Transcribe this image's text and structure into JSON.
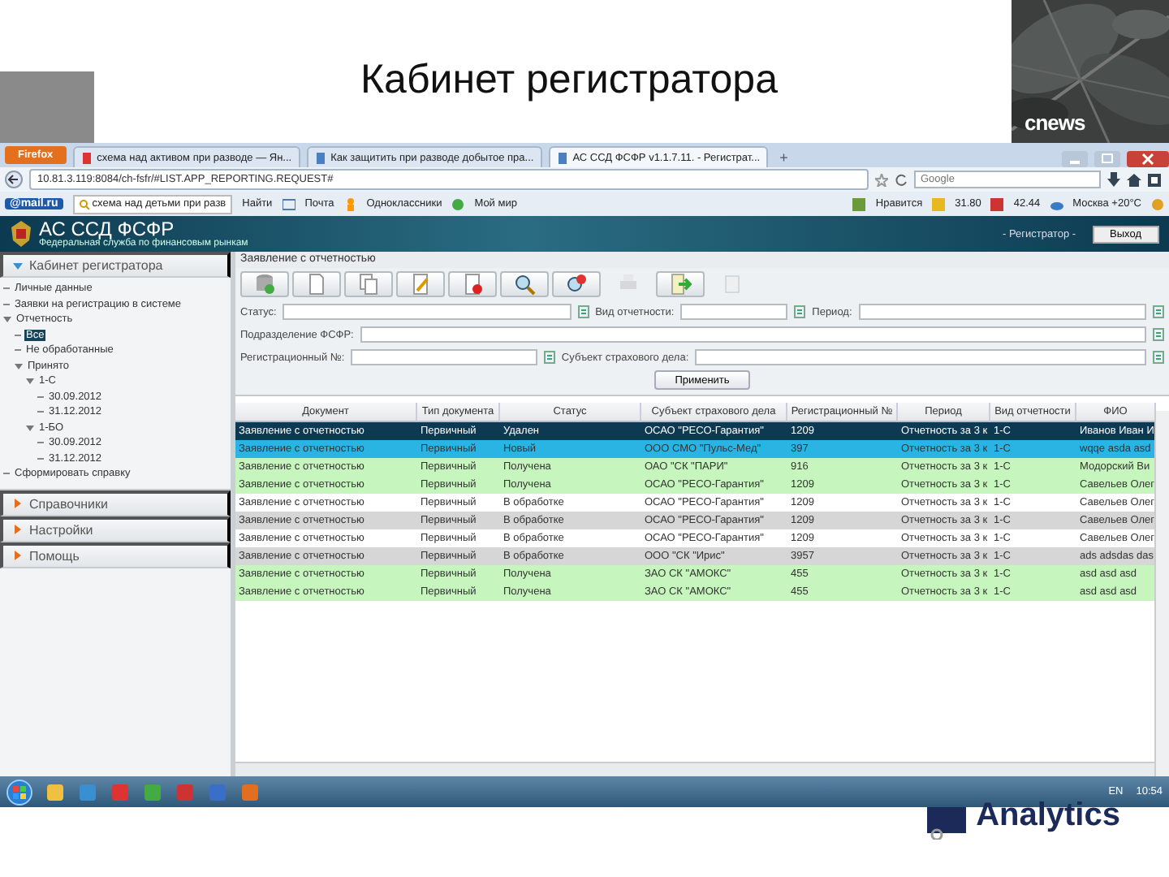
{
  "slide": {
    "title": "Кабинет регистратора",
    "logo": "cnews",
    "footer_logo": "Analytics"
  },
  "browser": {
    "menu_button": "Firefox",
    "tabs": [
      {
        "label": "схема над активом при разводе — Ян...",
        "selected": false
      },
      {
        "label": "Как защитить при разводе добытое пра...",
        "selected": false
      },
      {
        "label": "АС ССД ФСФР v1.1.7.11. - Регистрат...",
        "selected": true
      }
    ],
    "new_tab": "+",
    "address": "10.81.3.119:8084/ch-fsfr/#LIST.APP_REPORTING.REQUEST#",
    "search_placeholder": "Google"
  },
  "bookmarks": {
    "logo": "@mail.ru",
    "search": "схема над детьми при разв",
    "find": "Найти",
    "items": [
      "Почта",
      "Одноклассники",
      "Мой мир"
    ],
    "right_items": [
      "Нравится",
      "31.80",
      "42.44",
      "Москва +20°C"
    ]
  },
  "app": {
    "title": "АС ССД ФСФР",
    "subtitle": "Федеральная служба по финансовым рынкам",
    "user": "- Регистратор -",
    "logout": "Выход"
  },
  "sidebar": [
    {
      "label": "Кабинет регистратора",
      "expanded": true,
      "tree": [
        {
          "label": "Личные данные",
          "selected": false
        },
        {
          "label": "Заявки на регистрацию в системе",
          "selected": false
        },
        {
          "label": "Отчетность",
          "selected": false,
          "expanded": true,
          "children": [
            {
              "label": "Все",
              "selected": true
            },
            {
              "label": "Не обработанные",
              "selected": false
            },
            {
              "label": "Принято",
              "selected": false,
              "expanded": true,
              "children": [
                {
                  "label": "1-С",
                  "selected": false,
                  "expanded": true,
                  "children": [
                    {
                      "label": "30.09.2012",
                      "selected": false
                    },
                    {
                      "label": "31.12.2012",
                      "selected": false
                    }
                  ]
                },
                {
                  "label": "1-БО",
                  "selected": false,
                  "expanded": true,
                  "children": [
                    {
                      "label": "30.09.2012",
                      "selected": false
                    },
                    {
                      "label": "31.12.2012",
                      "selected": false
                    }
                  ]
                }
              ]
            }
          ]
        },
        {
          "label": "Сформировать справку",
          "selected": false
        }
      ]
    },
    {
      "label": "Справочники",
      "expanded": false
    },
    {
      "label": "Настройки",
      "expanded": false
    },
    {
      "label": "Помощь",
      "expanded": false
    }
  ],
  "panel": {
    "title": "Заявление с отчетностью",
    "toolbar": [
      {
        "kind": "database",
        "disabled": false
      },
      {
        "kind": "new",
        "disabled": false
      },
      {
        "kind": "copy",
        "disabled": false
      },
      {
        "kind": "edit",
        "disabled": false
      },
      {
        "kind": "delete",
        "disabled": false
      },
      {
        "kind": "search",
        "disabled": false
      },
      {
        "kind": "clear",
        "disabled": false
      },
      {
        "kind": "print",
        "disabled": true
      },
      {
        "kind": "export",
        "disabled": false
      },
      {
        "kind": "check",
        "disabled": true
      }
    ],
    "filters": [
      [
        {
          "label": "Статус:"
        },
        {
          "label": "Вид отчетности:"
        },
        {
          "label": "Период:"
        }
      ],
      [
        {
          "label": "Подразделение ФСФР:"
        }
      ],
      [
        {
          "label": "Регистрационный №:"
        },
        {
          "label": "Субъект страхового дела:"
        }
      ]
    ],
    "apply": "Применить"
  },
  "table": {
    "columns": [
      "Документ",
      "Тип документа",
      "Статус",
      "Субъект страхового дела",
      "Регистрационный №",
      "Период",
      "Вид отчетности",
      "ФИО"
    ],
    "rows": [
      {
        "color": "#0d3a52",
        "selected": true,
        "cells": [
          "Заявление с отчетностью",
          "Первичный",
          "Удален",
          "ОСАО \"РЕСО-Гарантия\"",
          "1209",
          "Отчетность за 3 к",
          "1-С",
          "Иванов Иван И"
        ]
      },
      {
        "color": "#2ab4e4",
        "selected": false,
        "cells": [
          "Заявление с отчетностью",
          "Первичный",
          "Новый",
          "ООО СМО \"Пульс-Мед\"",
          "397",
          "Отчетность за 3 к",
          "1-С",
          "wqqe asda asd"
        ]
      },
      {
        "color": "#c6f5bd",
        "selected": false,
        "cells": [
          "Заявление с отчетностью",
          "Первичный",
          "Получена",
          "ОАО \"СК \"ПАРИ\"",
          "916",
          "Отчетность за 3 к",
          "1-С",
          "Модорский Ви"
        ]
      },
      {
        "color": "#c6f5bd",
        "selected": false,
        "cells": [
          "Заявление с отчетностью",
          "Первичный",
          "Получена",
          "ОСАО \"РЕСО-Гарантия\"",
          "1209",
          "Отчетность за 3 к",
          "1-С",
          "Савельев Олег"
        ]
      },
      {
        "color": "#ffffff",
        "selected": false,
        "cells": [
          "Заявление с отчетностью",
          "Первичный",
          "В обработке",
          "ОСАО \"РЕСО-Гарантия\"",
          "1209",
          "Отчетность за 3 к",
          "1-С",
          "Савельев Олег"
        ]
      },
      {
        "color": "#d6d6d6",
        "selected": false,
        "cells": [
          "Заявление с отчетностью",
          "Первичный",
          "В обработке",
          "ОСАО \"РЕСО-Гарантия\"",
          "1209",
          "Отчетность за 3 к",
          "1-С",
          "Савельев Олег"
        ]
      },
      {
        "color": "#ffffff",
        "selected": false,
        "cells": [
          "Заявление с отчетностью",
          "Первичный",
          "В обработке",
          "ОСАО \"РЕСО-Гарантия\"",
          "1209",
          "Отчетность за 3 к",
          "1-С",
          "Савельев Олег"
        ]
      },
      {
        "color": "#d6d6d6",
        "selected": false,
        "cells": [
          "Заявление с отчетностью",
          "Первичный",
          "В обработке",
          "ООО \"СК \"Ирис\"",
          "3957",
          "Отчетность за 3 к",
          "1-С",
          "ads adsdas das"
        ]
      },
      {
        "color": "#c6f5bd",
        "selected": false,
        "cells": [
          "Заявление с отчетностью",
          "Первичный",
          "Получена",
          "ЗАО СК \"АМОКС\"",
          "455",
          "Отчетность за 3 к",
          "1-С",
          "asd asd asd"
        ]
      },
      {
        "color": "#c6f5bd",
        "selected": false,
        "cells": [
          "Заявление с отчетностью",
          "Первичный",
          "Получена",
          "ЗАО СК \"АМОКС\"",
          "455",
          "Отчетность за 3 к",
          "1-С",
          "asd asd asd"
        ]
      }
    ]
  },
  "taskbar": {
    "language": "EN",
    "time": "10:54"
  }
}
